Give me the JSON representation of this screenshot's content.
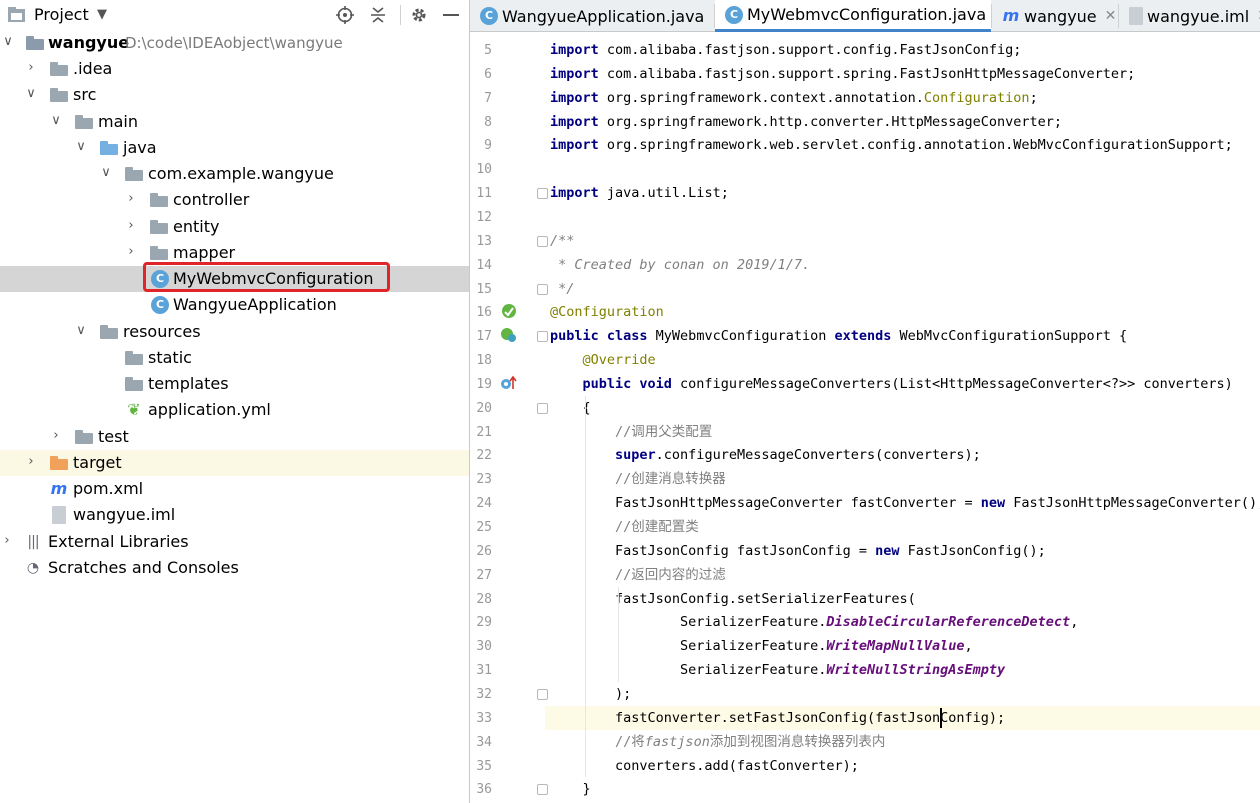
{
  "project_panel": {
    "title": "Project",
    "tree": [
      {
        "label": "wangyue",
        "path": "D:\\code\\IDEAobject\\wangyue",
        "depth": 0,
        "expanded": true,
        "icon": "module-folder-icon",
        "bold": true
      },
      {
        "label": ".idea",
        "depth": 1,
        "expanded": false,
        "icon": "folder-icon"
      },
      {
        "label": "src",
        "depth": 1,
        "expanded": true,
        "icon": "folder-icon"
      },
      {
        "label": "main",
        "depth": 2,
        "expanded": true,
        "icon": "folder-icon"
      },
      {
        "label": "java",
        "depth": 3,
        "expanded": true,
        "icon": "source-folder-icon"
      },
      {
        "label": "com.example.wangyue",
        "depth": 4,
        "expanded": true,
        "icon": "package-icon"
      },
      {
        "label": "controller",
        "depth": 5,
        "expanded": false,
        "icon": "package-icon"
      },
      {
        "label": "entity",
        "depth": 5,
        "expanded": false,
        "icon": "package-icon"
      },
      {
        "label": "mapper",
        "depth": 5,
        "expanded": false,
        "icon": "package-icon"
      },
      {
        "label": "MyWebmvcConfiguration",
        "depth": 5,
        "icon": "class-icon",
        "selected": true
      },
      {
        "label": "WangyueApplication",
        "depth": 5,
        "icon": "spring-boot-class-icon"
      },
      {
        "label": "resources",
        "depth": 3,
        "expanded": true,
        "icon": "resources-folder-icon"
      },
      {
        "label": "static",
        "depth": 4,
        "icon": "folder-icon"
      },
      {
        "label": "templates",
        "depth": 4,
        "icon": "folder-icon"
      },
      {
        "label": "application.yml",
        "depth": 4,
        "icon": "spring-yml-icon"
      },
      {
        "label": "test",
        "depth": 2,
        "expanded": false,
        "icon": "folder-icon"
      },
      {
        "label": "target",
        "depth": 1,
        "expanded": false,
        "icon": "excluded-folder-icon",
        "excluded": true
      },
      {
        "label": "pom.xml",
        "depth": 1,
        "icon": "maven-icon"
      },
      {
        "label": "wangyue.iml",
        "depth": 1,
        "icon": "iml-file-icon"
      },
      {
        "label": "External Libraries",
        "depth": 0,
        "expanded": false,
        "icon": "libraries-icon"
      },
      {
        "label": "Scratches and Consoles",
        "depth": 0,
        "icon": "scratches-icon"
      }
    ]
  },
  "tabs": [
    {
      "label": "WangyueApplication.java",
      "icon": "spring-boot-class-icon",
      "active": false
    },
    {
      "label": "MyWebmvcConfiguration.java",
      "icon": "class-icon",
      "active": true
    },
    {
      "label": "wangyue",
      "icon": "maven-icon",
      "active": false
    },
    {
      "label": "wangyue.iml",
      "icon": "iml-file-icon",
      "active": false
    }
  ],
  "editor": {
    "current_line": 33,
    "lines": [
      {
        "n": 5,
        "t": [
          [
            "kw0",
            "import"
          ],
          [
            "",
            "com.alibaba.fastjson.support.config.FastJsonConfig;"
          ]
        ]
      },
      {
        "n": 6,
        "t": [
          [
            "kw0",
            "import"
          ],
          [
            "",
            "com.alibaba.fastjson.support.spring.FastJsonHttpMessageConverter;"
          ]
        ]
      },
      {
        "n": 7,
        "t": [
          [
            "kw0",
            "import"
          ],
          [
            "",
            "org.springframework.context.annotation."
          ],
          [
            "ann",
            "Configuration"
          ],
          [
            "",
            ";"
          ]
        ]
      },
      {
        "n": 8,
        "t": [
          [
            "kw0",
            "import"
          ],
          [
            "",
            "org.springframework.http.converter.HttpMessageConverter;"
          ]
        ]
      },
      {
        "n": 9,
        "t": [
          [
            "kw0",
            "import"
          ],
          [
            "",
            "org.springframework.web.servlet.config.annotation.WebMvcConfigurationSupport;"
          ]
        ]
      },
      {
        "n": 10,
        "t": []
      },
      {
        "n": 11,
        "t": [
          [
            "kw0",
            "import"
          ],
          [
            "",
            "java.util.List;"
          ]
        ]
      },
      {
        "n": 12,
        "t": []
      },
      {
        "n": 13,
        "t": [
          [
            "cmi",
            "/**"
          ]
        ]
      },
      {
        "n": 14,
        "t": [
          [
            "cmi",
            " * Created by conan on 2019/1/7."
          ]
        ]
      },
      {
        "n": 15,
        "t": [
          [
            "cmi",
            " */"
          ]
        ]
      },
      {
        "n": 16,
        "t": [
          [
            "ann",
            "@Configuration"
          ]
        ]
      },
      {
        "n": 17,
        "t": [
          [
            "kw",
            "public class"
          ],
          [
            "",
            " MyWebmvcConfiguration "
          ],
          [
            "kw",
            "extends"
          ],
          [
            "",
            " WebMvcConfigurationSupport {"
          ]
        ]
      },
      {
        "n": 18,
        "t": [
          [
            "",
            "    "
          ],
          [
            "ann",
            "@Override"
          ]
        ]
      },
      {
        "n": 19,
        "t": [
          [
            "",
            "    "
          ],
          [
            "kw",
            "public void"
          ],
          [
            "",
            " configureMessageConverters(List<HttpMessageConverter<?>> converters)"
          ]
        ]
      },
      {
        "n": 20,
        "t": [
          [
            "",
            "    {"
          ]
        ]
      },
      {
        "n": 21,
        "t": [
          [
            "",
            "        "
          ],
          [
            "cm",
            "//调用父类配置"
          ]
        ]
      },
      {
        "n": 22,
        "t": [
          [
            "",
            "        "
          ],
          [
            "kw",
            "super"
          ],
          [
            "",
            ".configureMessageConverters(converters);"
          ]
        ]
      },
      {
        "n": 23,
        "t": [
          [
            "",
            "        "
          ],
          [
            "cm",
            "//创建消息转换器"
          ]
        ]
      },
      {
        "n": 24,
        "t": [
          [
            "",
            "        FastJsonHttpMessageConverter fastConverter = "
          ],
          [
            "kw",
            "new"
          ],
          [
            "",
            " FastJsonHttpMessageConverter();"
          ]
        ]
      },
      {
        "n": 25,
        "t": [
          [
            "",
            "        "
          ],
          [
            "cm",
            "//创建配置类"
          ]
        ]
      },
      {
        "n": 26,
        "t": [
          [
            "",
            "        FastJsonConfig fastJsonConfig = "
          ],
          [
            "kw",
            "new"
          ],
          [
            "",
            " FastJsonConfig();"
          ]
        ]
      },
      {
        "n": 27,
        "t": [
          [
            "",
            "        "
          ],
          [
            "cm",
            "//返回内容的过滤"
          ]
        ]
      },
      {
        "n": 28,
        "t": [
          [
            "",
            "        fastJsonConfig.setSerializerFeatures("
          ]
        ]
      },
      {
        "n": 29,
        "t": [
          [
            "",
            "                SerializerFeature."
          ],
          [
            "fld",
            "DisableCircularReferenceDetect"
          ],
          [
            "",
            ","
          ]
        ]
      },
      {
        "n": 30,
        "t": [
          [
            "",
            "                SerializerFeature."
          ],
          [
            "fld",
            "WriteMapNullValue"
          ],
          [
            "",
            ","
          ]
        ]
      },
      {
        "n": 31,
        "t": [
          [
            "",
            "                SerializerFeature."
          ],
          [
            "fld",
            "WriteNullStringAsEmpty"
          ]
        ]
      },
      {
        "n": 32,
        "t": [
          [
            "",
            "        );"
          ]
        ]
      },
      {
        "n": 33,
        "t": [
          [
            "",
            "        fastConverter.setFastJsonConfig(fastJsonConfig);"
          ]
        ]
      },
      {
        "n": 34,
        "t": [
          [
            "",
            "        "
          ],
          [
            "cm",
            "//将"
          ],
          [
            "cmi",
            "fastjson"
          ],
          [
            "cm",
            "添加到视图消息转换器列表内"
          ]
        ]
      },
      {
        "n": 35,
        "t": [
          [
            "",
            "        converters.add(fastConverter);"
          ]
        ]
      },
      {
        "n": 36,
        "t": [
          [
            "",
            "    }"
          ]
        ]
      }
    ]
  },
  "colors": {
    "keyword": "#000080",
    "annotation": "#808000",
    "comment": "#808080",
    "static_field": "#660e7a",
    "selection_box": "#e0242a",
    "active_tab_underline": "#4083c9"
  }
}
